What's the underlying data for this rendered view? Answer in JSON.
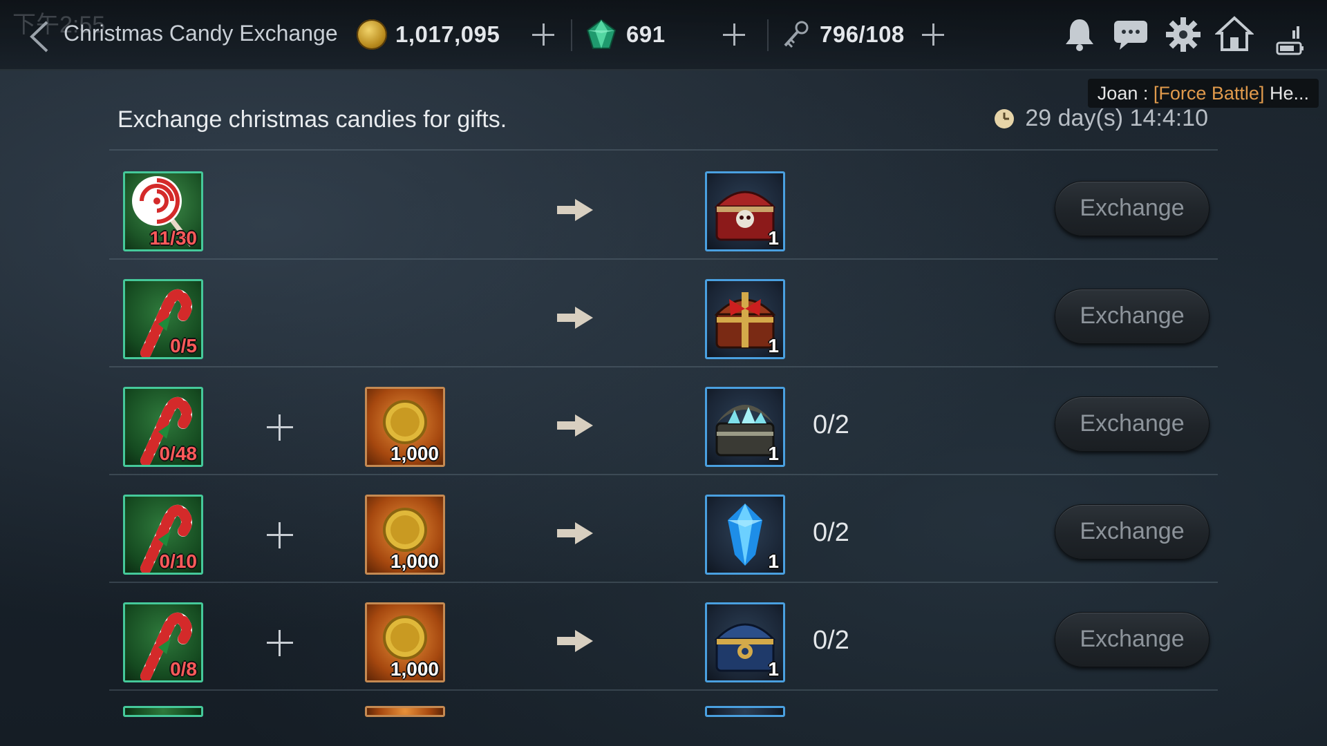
{
  "status_bar": {
    "time": "下午2:55"
  },
  "header": {
    "title": "Christmas Candy Exchange",
    "resources": [
      {
        "icon": "gold-coin-icon",
        "value": "1,017,095"
      },
      {
        "icon": "green-gem-icon",
        "value": "691"
      },
      {
        "icon": "stamina-key-icon",
        "value": "796/108"
      }
    ],
    "icons": [
      "bell-icon",
      "chat-bubble-icon",
      "gear-icon",
      "home-icon"
    ]
  },
  "chat": {
    "sender": "Joan :",
    "tag": "[Force Battle]",
    "text": "He..."
  },
  "event": {
    "description": "Exchange christmas candies for gifts.",
    "remaining": "29 day(s) 14:4:10"
  },
  "rows": [
    {
      "input": {
        "item": "lollipop",
        "count": "11/30"
      },
      "extra": null,
      "reward": {
        "item": "red-skull-chest",
        "count": "1"
      },
      "limit": "",
      "button": "Exchange"
    },
    {
      "input": {
        "item": "candy-cane",
        "count": "0/5"
      },
      "extra": null,
      "reward": {
        "item": "red-ribbon-chest",
        "count": "1"
      },
      "limit": "",
      "button": "Exchange"
    },
    {
      "input": {
        "item": "candy-cane",
        "count": "0/48"
      },
      "extra": {
        "item": "gold-coin",
        "count": "1,000"
      },
      "reward": {
        "item": "crystal-chest",
        "count": "1"
      },
      "limit": "0/2",
      "button": "Exchange"
    },
    {
      "input": {
        "item": "candy-cane",
        "count": "0/10"
      },
      "extra": {
        "item": "gold-coin",
        "count": "1,000"
      },
      "reward": {
        "item": "blue-crystal",
        "count": "1"
      },
      "limit": "0/2",
      "button": "Exchange"
    },
    {
      "input": {
        "item": "candy-cane",
        "count": "0/8"
      },
      "extra": {
        "item": "gold-coin",
        "count": "1,000"
      },
      "reward": {
        "item": "blue-gold-chest",
        "count": "1"
      },
      "limit": "0/2",
      "button": "Exchange"
    }
  ],
  "colors": {
    "count_red": "#ff5a5a",
    "chat_tag": "#e09a4c",
    "slot_border_green": "#45c99a",
    "slot_border_blue": "#4aa0e0"
  }
}
